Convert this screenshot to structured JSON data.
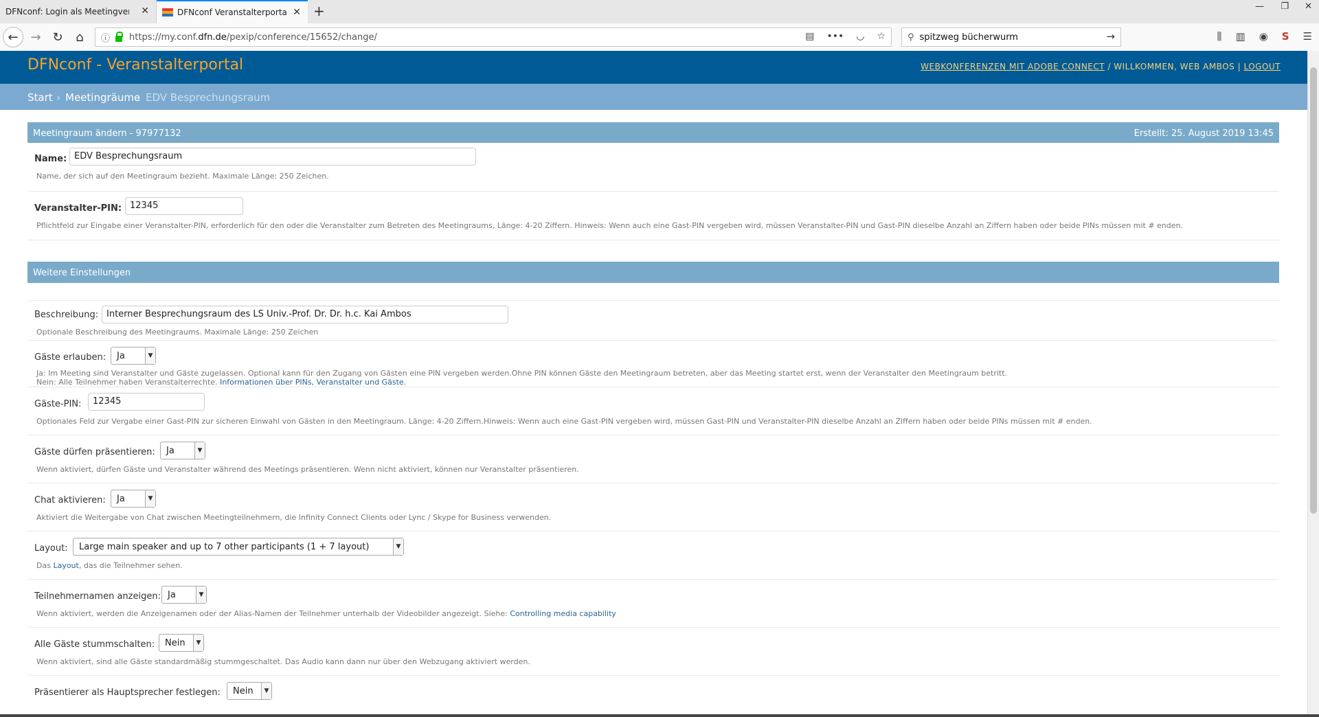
{
  "browser": {
    "tabs": [
      {
        "title": "DFNconf: Login als Meetingveranst"
      },
      {
        "title": "DFNconf Veranstalterportal"
      }
    ],
    "new_tab_label": "+",
    "url_prefix": "https://my.conf.",
    "url_host": "dfn.de",
    "url_path": "/pexip/conference/15652/change/",
    "search_value": "spitzweg bücherwurm",
    "icons": [
      "back-icon",
      "forward-icon",
      "reload-icon",
      "home-icon",
      "info-icon",
      "lock-icon",
      "reader-icon",
      "more-icon",
      "pocket-icon",
      "bookmark-star-icon",
      "search-icon",
      "library-icon",
      "sidebar-icon",
      "extension-icon",
      "menu-icon"
    ]
  },
  "header": {
    "title": "DFNconf - Veranstalterportal",
    "link_adobe": "WEBKONFERENZEN MIT ADOBE CONNECT",
    "welcome": "WILLKOMMEN, WEB AMBOS",
    "logout": "LOGOUT"
  },
  "breadcrumb": {
    "start": "Start",
    "rooms": "Meetingräume",
    "current": "EDV Besprechungsraum",
    "separator": "›"
  },
  "form": {
    "caption_left": "Meetingraum ändern - 97977132",
    "caption_right": "Erstellt: 25. August 2019 13:45",
    "name": {
      "label": "Name:",
      "value": "EDV Besprechungsraum",
      "help": "Name, der sich auf den Meetingraum bezieht. Maximale Länge: 250 Zeichen."
    },
    "host_pin": {
      "label": "Veranstalter-PIN:",
      "value": "12345",
      "help": "Pflichtfeld zur Eingabe einer Veranstalter-PIN, erforderlich für den oder die Veranstalter zum Betreten des Meetingraums, Länge: 4-20 Ziffern. Hinweis: Wenn auch eine Gast-PIN vergeben wird, müssen Veranstalter-PIN und Gast-PIN dieselbe Anzahl an Ziffern haben oder beide PINs müssen mit # enden."
    }
  },
  "settings": {
    "caption": "Weitere Einstellungen",
    "description": {
      "label": "Beschreibung:",
      "value": "Interner Besprechungsraum des LS Univ.-Prof. Dr. Dr. h.c. Kai Ambos",
      "help": "Optionale Beschreibung des Meetingraums. Maximale Länge: 250 Zeichen"
    },
    "allow_guests": {
      "label": "Gäste erlauben:",
      "value": "Ja",
      "help1": "Ja: Im Meeting sind Veranstalter und Gäste zugelassen. Optional kann für den Zugang von Gästen eine PIN vergeben werden.Ohne PIN können Gäste den Meetingraum betreten, aber das Meeting startet erst, wenn der Veranstalter den Meetingraum betritt.",
      "help2": "Nein: Alle Teilnehmer haben Veranstalterrechte.",
      "help2_link": "Informationen über PINs, Veranstalter und Gäste."
    },
    "guest_pin": {
      "label": "Gäste-PIN:",
      "value": "12345",
      "help": "Optionales Feld zur Vergabe einer Gast-PIN zur sicheren Einwahl von Gästen in den Meetingraum. Länge: 4-20 Ziffern.Hinweis: Wenn auch eine Gast-PIN vergeben wird, müssen Gast-PIN und Veranstalter-PIN dieselbe Anzahl an Ziffern haben oder beide PINs müssen mit # enden."
    },
    "guests_present": {
      "label": "Gäste dürfen präsentieren:",
      "value": "Ja",
      "help": "Wenn aktiviert, dürfen Gäste und Veranstalter während des Meetings präsentieren. Wenn nicht aktiviert, können nur Veranstalter präsentieren."
    },
    "chat": {
      "label": "Chat aktivieren:",
      "value": "Ja",
      "help": "Aktiviert die Weitergabe von Chat zwischen Meetingteilnehmern, die Infinity Connect Clients oder Lync / Skype for Business verwenden."
    },
    "layout": {
      "label": "Layout:",
      "value": "Large main speaker and up to 7 other participants (1 + 7 layout)",
      "help_prefix": "Das",
      "help_link": "Layout",
      "help_suffix": ", das die Teilnehmer sehen."
    },
    "show_names": {
      "label": "Teilnehmernamen anzeigen:",
      "value": "Ja",
      "help": "Wenn aktiviert, werden die Anzeigenamen oder der Alias-Namen der Teilnehmer unterhalb der Videobilder angezeigt. Siehe:",
      "help_link": "Controlling media capability"
    },
    "mute_guests": {
      "label": "Alle Gäste stummschalten:",
      "value": "Nein",
      "help": "Wenn aktiviert, sind alle Gäste standardmäßig stummgeschaltet. Das Audio kann dann nur über den Webzugang aktiviert werden."
    },
    "main_speaker": {
      "label": "Präsentierer als Hauptsprecher festlegen:",
      "value": "Nein"
    }
  }
}
